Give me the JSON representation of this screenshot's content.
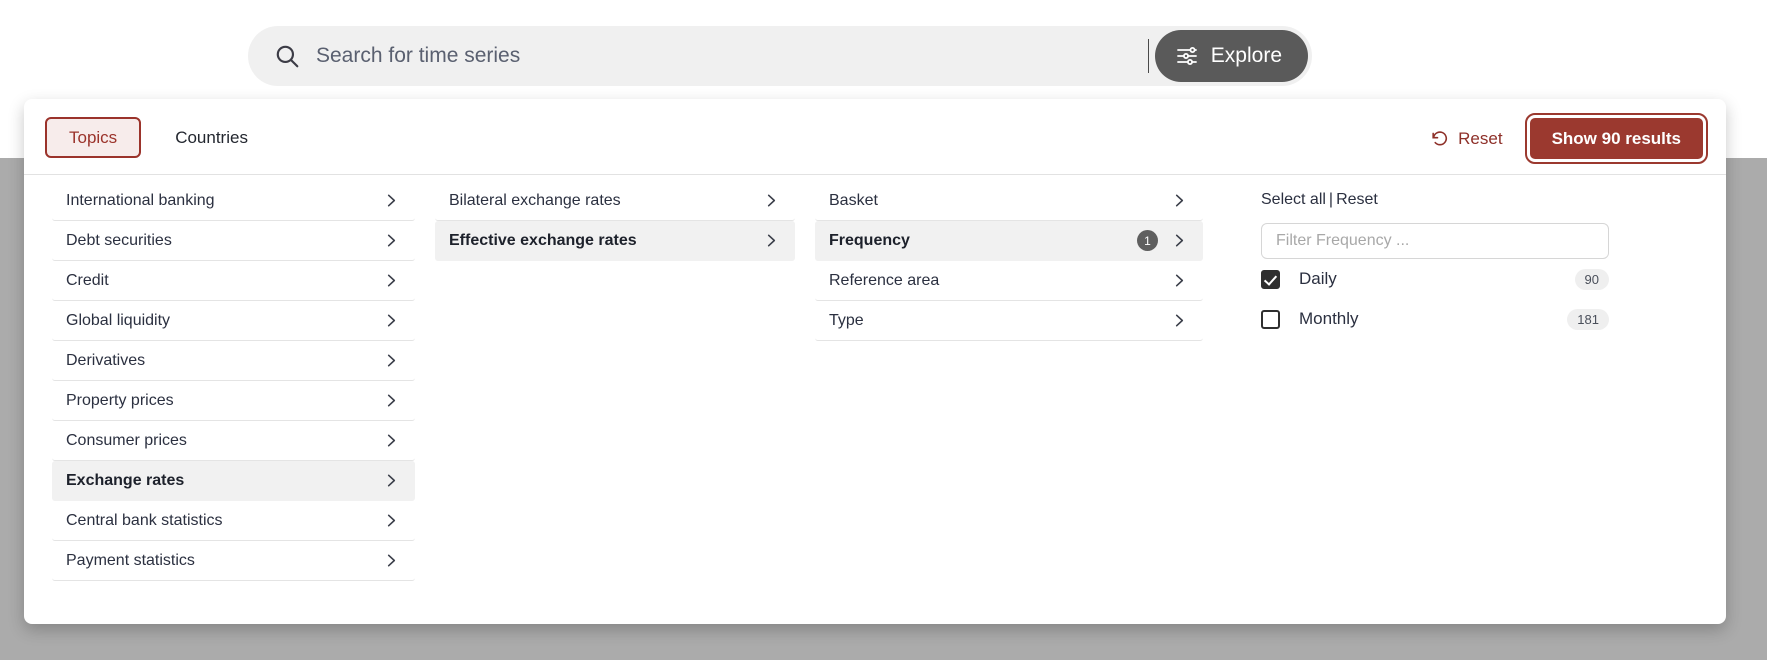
{
  "search": {
    "placeholder": "Search for time series",
    "value": "",
    "icon": "search-icon",
    "explore_label": "Explore",
    "explore_icon": "sliders-icon"
  },
  "panel": {
    "tabs": [
      {
        "label": "Topics",
        "active": true
      },
      {
        "label": "Countries",
        "active": false
      }
    ],
    "reset_label": "Reset",
    "reset_icon": "undo-icon",
    "show_results_label": "Show 90 results",
    "accent_color": "#9b392f",
    "tab_active_bg": "#f7eceb"
  },
  "column1": {
    "items": [
      {
        "label": "International banking",
        "selected": false,
        "chevron": true
      },
      {
        "label": "Debt securities",
        "selected": false,
        "chevron": true
      },
      {
        "label": "Credit",
        "selected": false,
        "chevron": true
      },
      {
        "label": "Global liquidity",
        "selected": false,
        "chevron": true
      },
      {
        "label": "Derivatives",
        "selected": false,
        "chevron": true
      },
      {
        "label": "Property prices",
        "selected": false,
        "chevron": true
      },
      {
        "label": "Consumer prices",
        "selected": false,
        "chevron": true
      },
      {
        "label": "Exchange rates",
        "selected": true,
        "chevron": true
      },
      {
        "label": "Central bank statistics",
        "selected": false,
        "chevron": true
      },
      {
        "label": "Payment statistics",
        "selected": false,
        "chevron": true
      }
    ]
  },
  "column2": {
    "items": [
      {
        "label": "Bilateral exchange rates",
        "selected": false,
        "chevron": true
      },
      {
        "label": "Effective exchange rates",
        "selected": true,
        "chevron": true
      }
    ]
  },
  "column3": {
    "items": [
      {
        "label": "Basket",
        "selected": false,
        "chevron": true,
        "badge": ""
      },
      {
        "label": "Frequency",
        "selected": true,
        "chevron": true,
        "badge": "1"
      },
      {
        "label": "Reference area",
        "selected": false,
        "chevron": true,
        "badge": ""
      },
      {
        "label": "Type",
        "selected": false,
        "chevron": true,
        "badge": ""
      }
    ]
  },
  "facets": {
    "select_all_label": "Select all",
    "separator": "|",
    "reset_label": "Reset",
    "filter_placeholder": "Filter Frequency ...",
    "filter_value": "",
    "options": [
      {
        "label": "Daily",
        "count": "90",
        "checked": true
      },
      {
        "label": "Monthly",
        "count": "181",
        "checked": false
      }
    ]
  }
}
